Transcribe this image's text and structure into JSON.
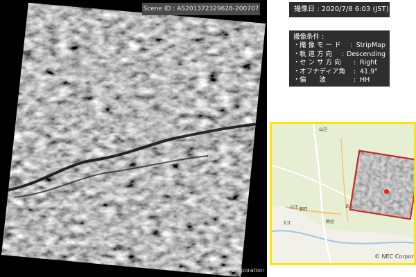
{
  "scene_id": "Scene ID : AS201372329628-200707",
  "capture_date": "撮像日 : 2020/7/8 6:03 (JST)",
  "conditions": {
    "title": "撮像条件 :",
    "rows": [
      {
        "bullet": "・",
        "label": "撮 像 モ ー ド",
        "value": "StripMap"
      },
      {
        "bullet": "・",
        "label": "軌 道 方 向",
        "value": "Descending"
      },
      {
        "bullet": "・",
        "label": "セ ン サ 方 向",
        "value": "Right"
      },
      {
        "bullet": "・",
        "label": "オフナディア角",
        "value": "41.9°"
      },
      {
        "bullet": "・",
        "label": "偏　　波",
        "value": "HH"
      }
    ]
  },
  "credit": "NEC Corporation",
  "map": {
    "credit": "© NEC Corporation",
    "places": [
      "山辺",
      "朝日",
      "大江",
      "山江",
      "あさひ",
      "雨谷"
    ]
  },
  "colors": {
    "highlight_frame": "#ffe500",
    "marker": "#ff1a1a"
  }
}
